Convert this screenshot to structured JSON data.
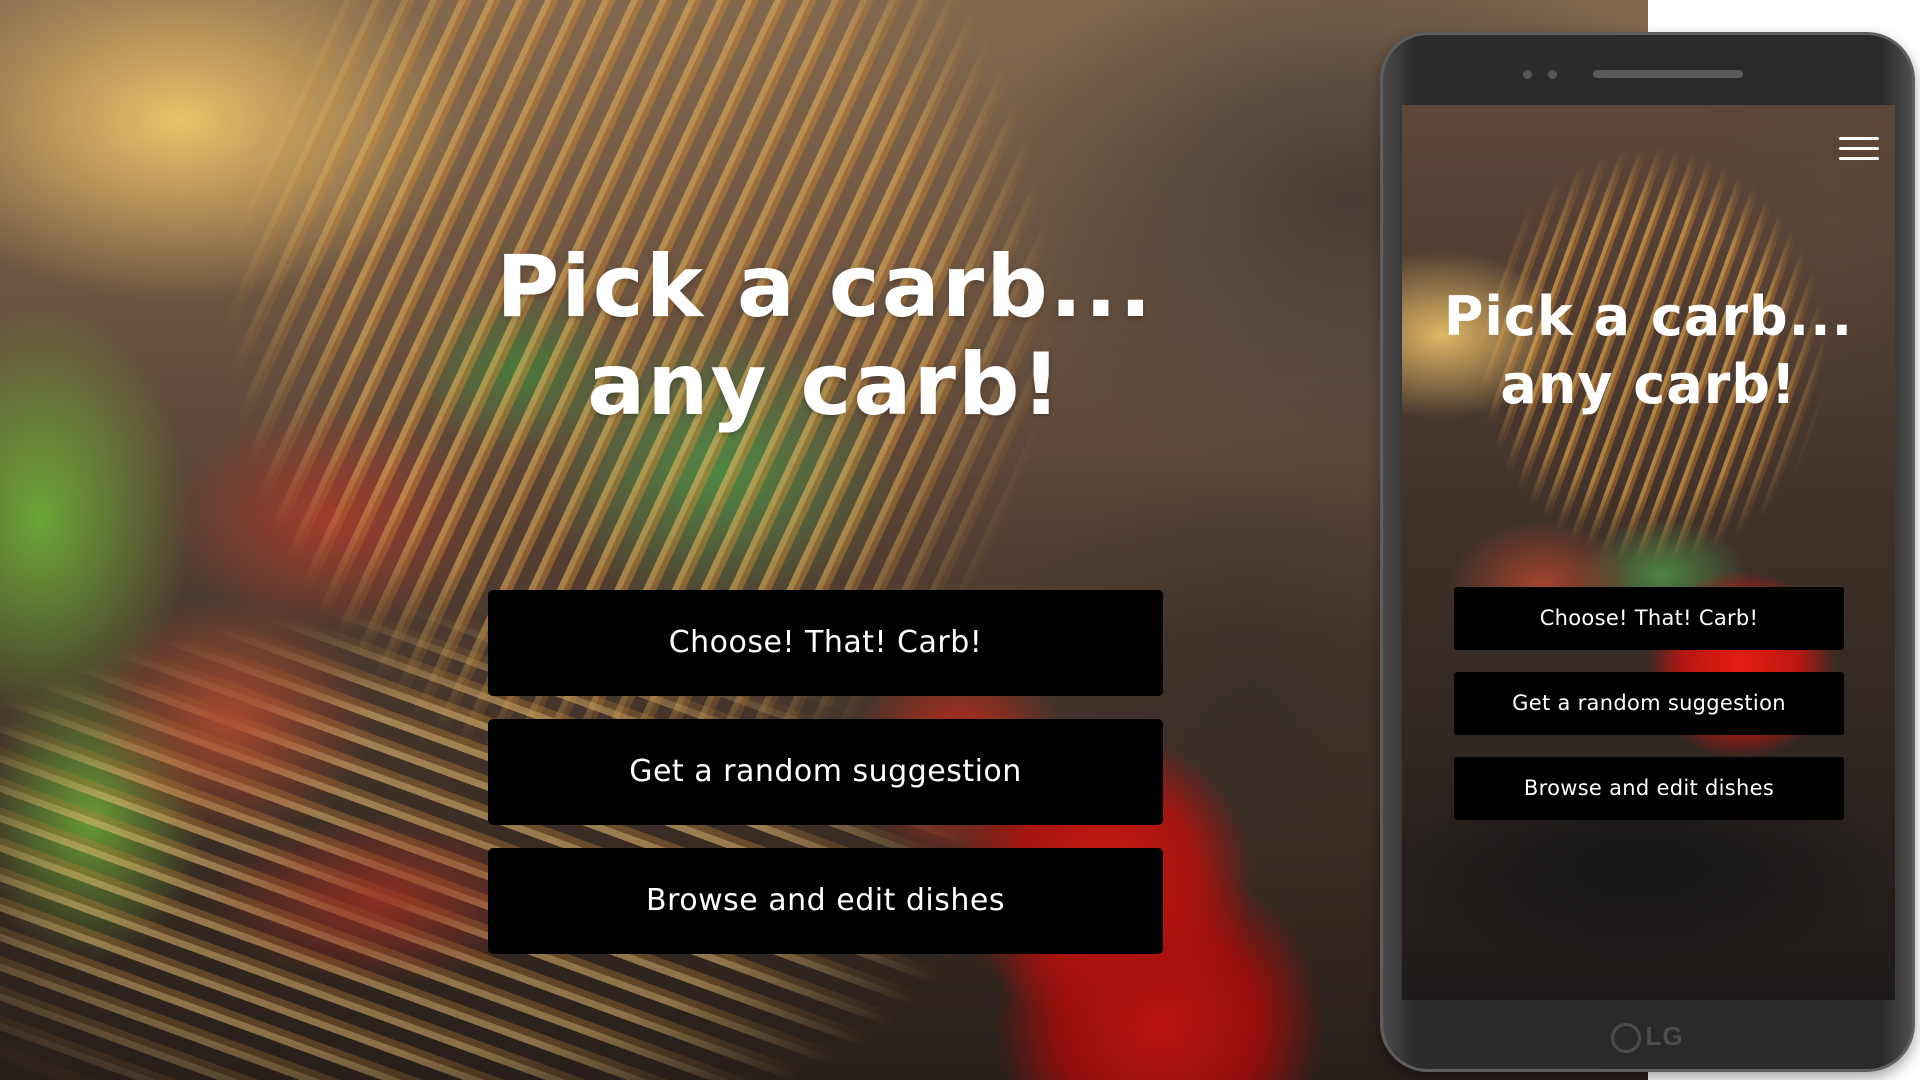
{
  "desktop": {
    "title_line1": "Pick a carb...",
    "title_line2": "any carb!",
    "buttons": [
      {
        "label": "Choose! That! Carb!"
      },
      {
        "label": "Get a random suggestion"
      },
      {
        "label": "Browse and edit dishes"
      }
    ]
  },
  "mobile": {
    "menu_icon": "hamburger-menu-icon",
    "title_line1": "Pick a carb...",
    "title_line2": "any carb!",
    "buttons": [
      {
        "label": "Choose! That! Carb!"
      },
      {
        "label": "Get a random suggestion"
      },
      {
        "label": "Browse and edit dishes"
      }
    ],
    "device_brand": "LG"
  },
  "colors": {
    "button_bg": "#000000",
    "button_text": "#ffffff",
    "title_text": "#ffffff",
    "phone_body": "#2b2b2b"
  }
}
